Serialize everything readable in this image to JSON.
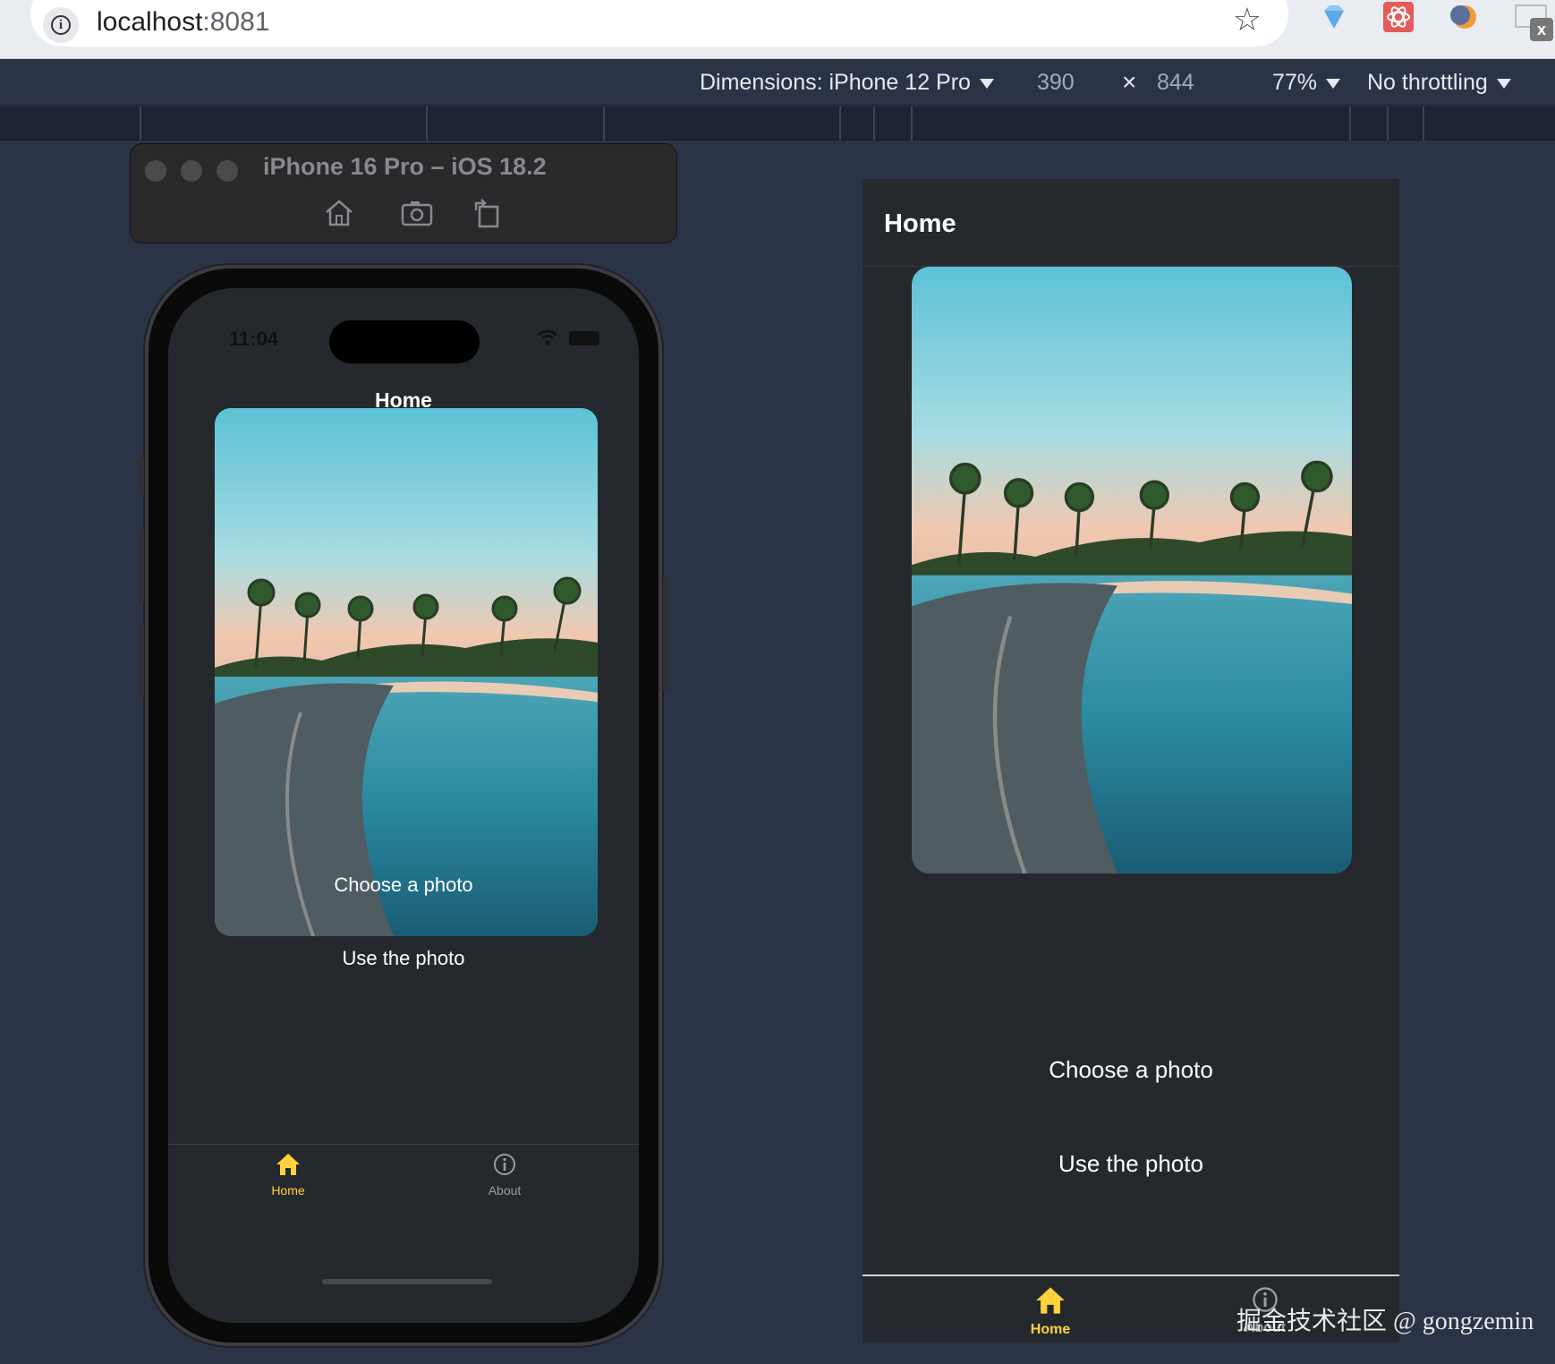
{
  "browser": {
    "url_host": "localhost",
    "url_port": ":8081",
    "icons": [
      "info-icon",
      "star-icon",
      "gem-extension-icon",
      "react-devtools-icon",
      "moon-extension-icon",
      "close-x-extension-icon"
    ]
  },
  "device_toolbar": {
    "dimensions_label": "Dimensions: iPhone 12 Pro",
    "width": "390",
    "times": "×",
    "height": "844",
    "zoom": "77%",
    "throttling": "No throttling"
  },
  "simulator": {
    "title": "iPhone 16 Pro – iOS 18.2",
    "buttons": [
      "home-icon",
      "screenshot-icon",
      "rotate-icon"
    ]
  },
  "phone": {
    "time": "11:04",
    "title": "Home",
    "choose_button": "Choose a photo",
    "use_button": "Use the photo",
    "tabs": [
      {
        "label": "Home",
        "icon": "home-icon",
        "active": true
      },
      {
        "label": "About",
        "icon": "info-circle-icon",
        "active": false
      }
    ]
  },
  "web": {
    "title": "Home",
    "choose_button": "Choose a photo",
    "use_button": "Use the photo",
    "tabs": [
      {
        "label": "Home",
        "icon": "home-icon",
        "active": true
      },
      {
        "label": "About",
        "icon": "info-circle-icon",
        "active": false
      }
    ]
  },
  "watermark": "掘金技术社区 @ gongzemin",
  "colors": {
    "background": "#2b3347",
    "app_background": "#25292e",
    "active_tab": "#ffd33d",
    "inactive_tab": "#9a9ea5",
    "text": "#ffffff"
  }
}
